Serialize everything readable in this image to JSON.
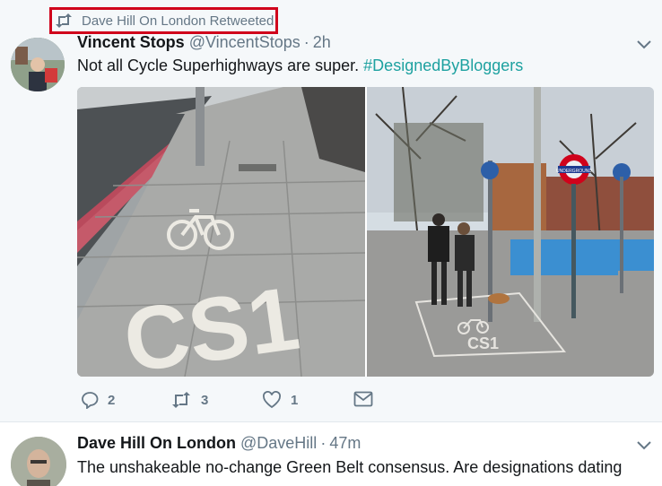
{
  "retweet_context": {
    "label": "Dave Hill On London Retweeted"
  },
  "tweet1": {
    "name": "Vincent Stops",
    "handle": "@VincentStops",
    "time": "2h",
    "text": "Not all Cycle Superhighways are super.",
    "hashtag": "#DesignedByBloggers",
    "photo_left_marking": "CS1",
    "photo_right_marking": "CS1",
    "photo_right_sign": "UNDERGROUND",
    "actions": {
      "replies": "2",
      "retweets": "3",
      "likes": "1"
    }
  },
  "tweet2": {
    "name": "Dave Hill On London",
    "handle": "@DaveHill",
    "time": "47m",
    "text": "The unshakeable no-change Green Belt consensus. Are designations dating"
  },
  "colors": {
    "accent": "#1da1a0",
    "muted": "#657786",
    "highlight_box": "#d0021b"
  }
}
